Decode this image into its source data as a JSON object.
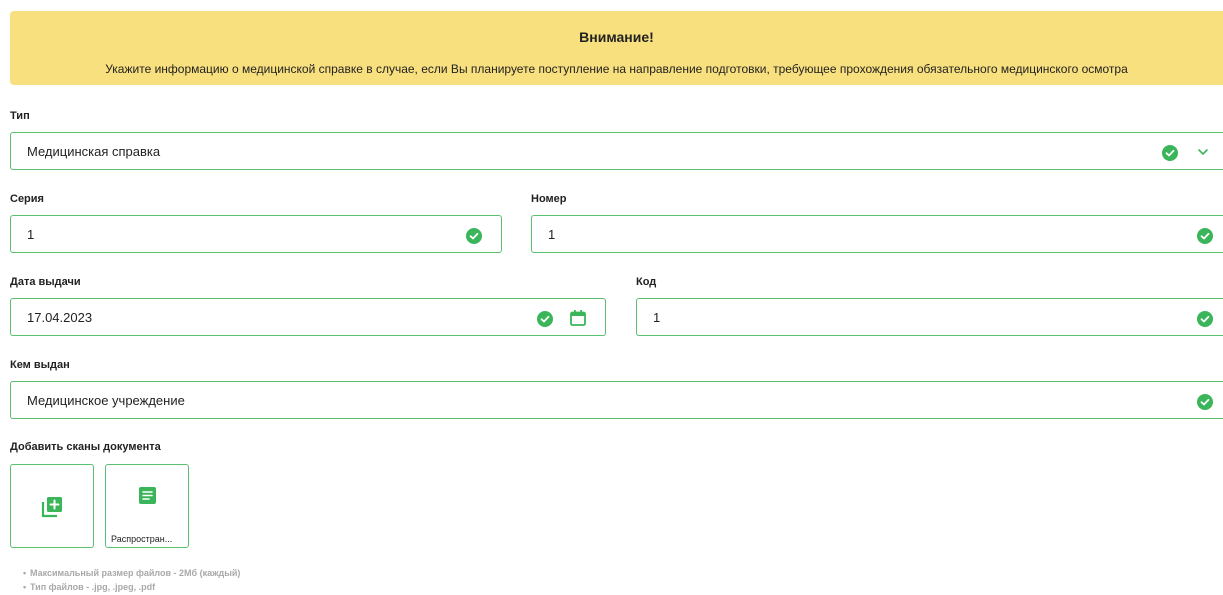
{
  "alert": {
    "title": "Внимание!",
    "text": "Укажите информацию о медицинской справке в случае, если Вы планируете поступление на направление подготовки, требующее прохождения обязательного медицинского осмотра"
  },
  "type_field": {
    "label": "Тип",
    "value": "Медицинская справка"
  },
  "series_field": {
    "label": "Серия",
    "value": "1"
  },
  "number_field": {
    "label": "Номер",
    "value": "1"
  },
  "issue_date_field": {
    "label": "Дата выдачи",
    "value": "17.04.2023"
  },
  "code_field": {
    "label": "Код",
    "value": "1"
  },
  "issued_by_field": {
    "label": "Кем выдан",
    "value": "Медицинское учреждение"
  },
  "scans": {
    "label": "Добавить сканы документа",
    "files": [
      {
        "name": "Распростран..."
      }
    ],
    "notes": [
      "Максимальный размер файлов - 2Мб (каждый)",
      "Тип файлов - .jpg, .jpeg, .pdf"
    ]
  },
  "colors": {
    "alert_bg": "#f9e07e",
    "accent_green": "#3ab55a",
    "border_green": "#5bbf72"
  },
  "icons": [
    "check-circle-icon",
    "chevron-down-icon",
    "calendar-icon",
    "add-file-icon",
    "document-icon"
  ]
}
